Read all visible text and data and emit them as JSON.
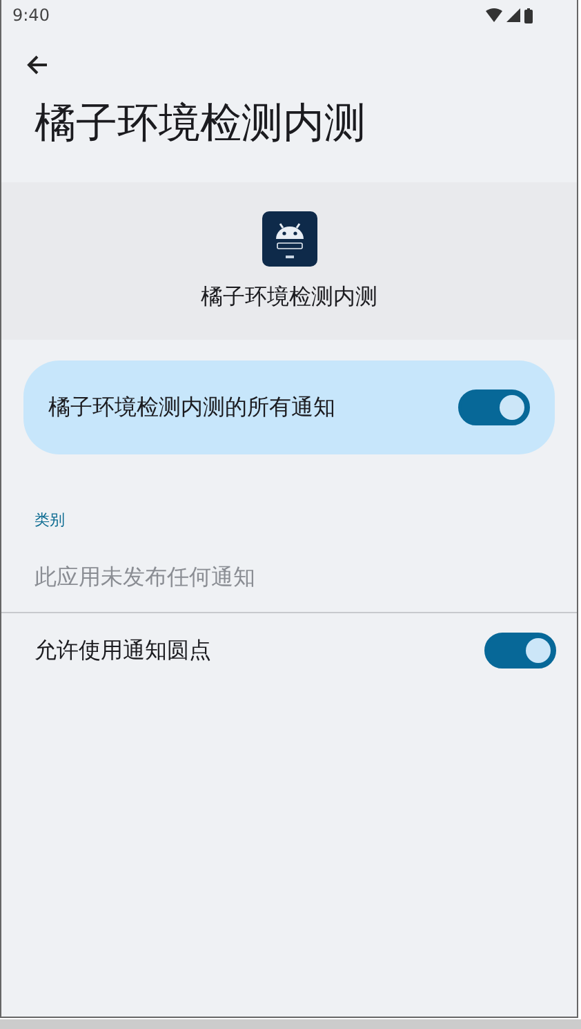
{
  "status_bar": {
    "time": "9:40"
  },
  "title": "橘子环境检测内测",
  "app_header": {
    "name": "橘子环境检测内测"
  },
  "master_toggle": {
    "label": "橘子环境检测内测的所有通知",
    "on": true
  },
  "category_heading": "类别",
  "empty_message": "此应用未发布任何通知",
  "settings": [
    {
      "label": "允许使用通知圆点",
      "on": true
    }
  ]
}
